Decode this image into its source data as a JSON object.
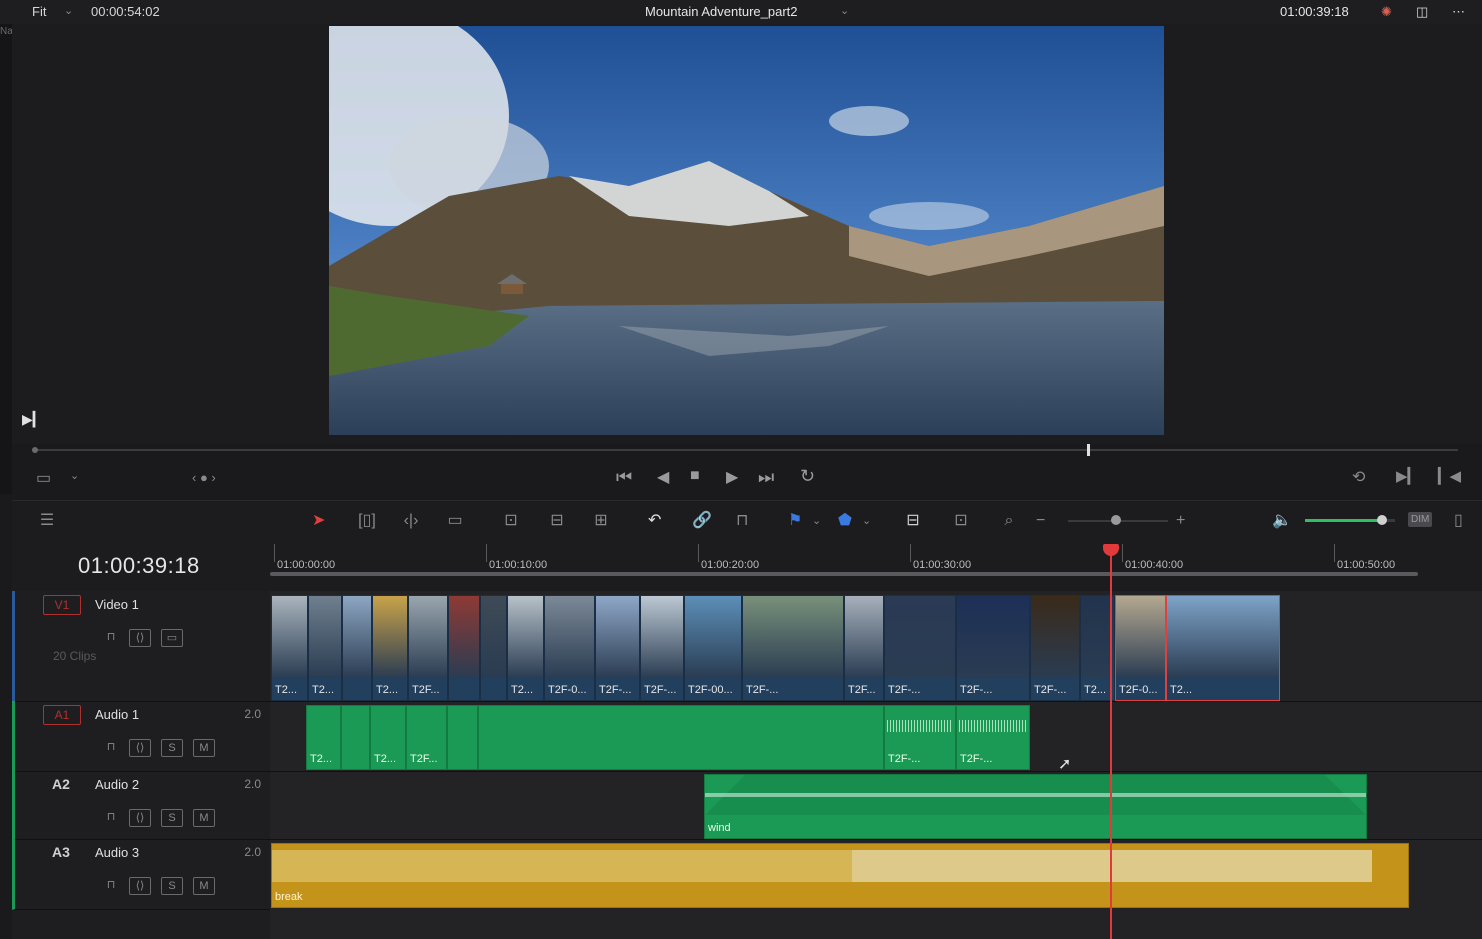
{
  "topbar": {
    "fit_label": "Fit",
    "source_timecode": "00:00:54:02",
    "title": "Mountain Adventure_part2",
    "record_timecode": "01:00:39:18",
    "panel_label": "Na"
  },
  "viewer": {
    "playhead_fraction": 0.74
  },
  "timeline": {
    "timecode": "01:00:39:18",
    "ruler_ticks": [
      "01:00:00:00",
      "01:00:10:00",
      "01:00:20:00",
      "01:00:30:00",
      "01:00:40:00",
      "01:00:50:00"
    ],
    "clip_count_label": "20 Clips",
    "tracks": [
      {
        "tag": "V1",
        "name": "Video 1",
        "channels": ""
      },
      {
        "tag": "A1",
        "name": "Audio 1",
        "channels": "2.0"
      },
      {
        "tag": "A2",
        "name": "Audio 2",
        "channels": "2.0"
      },
      {
        "tag": "A3",
        "name": "Audio 3",
        "channels": "2.0"
      }
    ],
    "video_clips": [
      "T2...",
      "T2...",
      "",
      "T2...",
      "T2F...",
      "",
      "",
      "T2...",
      "T2F-0...",
      "T2F-...",
      "T2F-...",
      "T2F-00...",
      "T2F-...",
      "T2F...",
      "T2F-...",
      "T2F-...",
      "T2F-...",
      "T2...",
      "T2F-0...",
      "T2..."
    ],
    "a1_clips": [
      "T2...",
      "",
      "T2...",
      "T2F...",
      "",
      "",
      "T2F-...",
      "T2F-..."
    ],
    "a2_clip": "wind",
    "a3_clip": "break",
    "track_buttons": {
      "solo": "S",
      "mute": "M"
    },
    "dim_label": "DIM",
    "volume_fraction": 0.85
  },
  "colors": {
    "background": "#1a1a1c",
    "video_clip": "#22405e",
    "audio_green": "#1a9a55",
    "audio_gold": "#c4941a",
    "playhead": "#e23a3a",
    "track_tag": "#b03030"
  },
  "icons": [
    "play-icon",
    "skip-start-icon",
    "step-back-icon",
    "stop-icon",
    "play-forward-icon",
    "skip-end-icon",
    "loop-icon",
    "selection-tool-icon",
    "trim-icon",
    "blade-icon",
    "snapping-icon",
    "link-icon",
    "lock-icon",
    "flag-icon",
    "marker-icon",
    "zoom-icon",
    "volume-icon"
  ]
}
